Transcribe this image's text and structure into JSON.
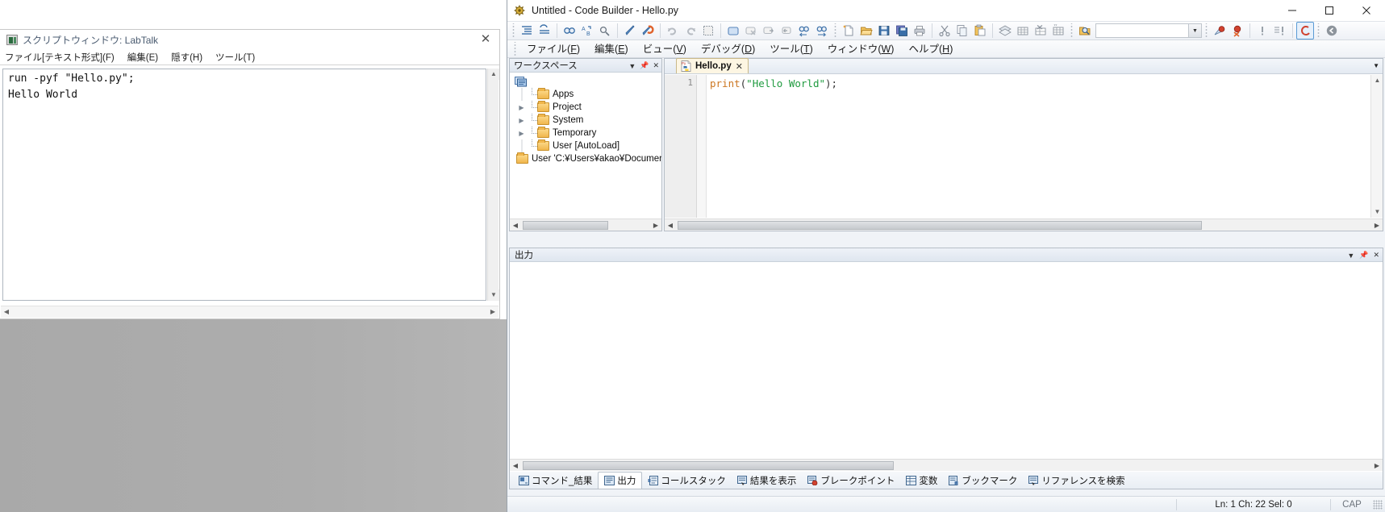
{
  "labtalk": {
    "title": "スクリプトウィンドウ: LabTalk",
    "icon": "script-window-icon",
    "close_label": "✕",
    "menus": [
      {
        "label": "ファイル[テキスト形式](F)"
      },
      {
        "label": "編集(E)"
      },
      {
        "label": "隠す(H)"
      },
      {
        "label": "ツール(T)"
      }
    ],
    "content_line1": "run -pyf \"Hello.py\";",
    "content_line2": "Hello World"
  },
  "codebuilder": {
    "title": "Untitled - Code Builder - Hello.py",
    "window_buttons": {
      "minimize": "minimize-button",
      "maximize": "maximize-button",
      "close": "close-button"
    },
    "toolbar_groups": [
      {
        "buttons": [
          {
            "name": "indent-lines-icon"
          },
          {
            "name": "unindent-lines-icon"
          }
        ]
      },
      {
        "buttons": [
          {
            "name": "find-icon"
          },
          {
            "name": "replace-icon"
          },
          {
            "name": "find-in-files-icon"
          }
        ]
      },
      {
        "buttons": [
          {
            "name": "build-icon"
          },
          {
            "name": "rebuild-icon"
          }
        ]
      },
      {
        "buttons": [
          {
            "name": "undo-icon"
          },
          {
            "name": "redo-icon"
          },
          {
            "name": "select-all-icon"
          }
        ]
      },
      {
        "buttons": [
          {
            "name": "run-icon"
          },
          {
            "name": "stop-icon"
          },
          {
            "name": "step-over-icon"
          },
          {
            "name": "step-out-icon"
          },
          {
            "name": "find-prev-icon"
          },
          {
            "name": "find-next-icon"
          }
        ]
      },
      {
        "buttons": [
          {
            "name": "new-file-icon"
          },
          {
            "name": "open-file-icon"
          },
          {
            "name": "save-icon"
          },
          {
            "name": "save-all-icon"
          },
          {
            "name": "print-icon"
          }
        ]
      },
      {
        "buttons": [
          {
            "name": "cut-icon"
          },
          {
            "name": "copy-icon"
          },
          {
            "name": "paste-icon"
          }
        ]
      },
      {
        "buttons": [
          {
            "name": "layers-icon"
          },
          {
            "name": "add-watch-icon"
          },
          {
            "name": "remove-watch-icon"
          },
          {
            "name": "new-watch-icon"
          }
        ]
      },
      {
        "buttons": [
          {
            "name": "search-folder-icon"
          }
        ],
        "combo": {
          "name": "search-combo",
          "value": "",
          "placeholder": ""
        }
      },
      {
        "buttons": [
          {
            "name": "breakpoint-icon"
          },
          {
            "name": "remove-breakpoint-icon"
          }
        ]
      },
      {
        "buttons": [
          {
            "name": "break-icon"
          },
          {
            "name": "break-all-icon"
          }
        ]
      },
      {
        "buttons": [
          {
            "name": "compile-icon"
          }
        ]
      },
      {
        "buttons": [
          {
            "name": "back-icon"
          }
        ]
      }
    ],
    "menus": [
      {
        "label": "ファイル",
        "accel": "F"
      },
      {
        "label": "編集",
        "accel": "E"
      },
      {
        "label": "ビュー",
        "accel": "V"
      },
      {
        "label": "デバッグ",
        "accel": "D"
      },
      {
        "label": "ツール",
        "accel": "T"
      },
      {
        "label": "ウィンドウ",
        "accel": "W"
      },
      {
        "label": "ヘルプ",
        "accel": "H"
      }
    ],
    "workspace": {
      "title": "ワークスペース",
      "root_icon": "workspace-root-icon",
      "items": [
        {
          "label": "Apps",
          "expandable": false
        },
        {
          "label": "Project",
          "expandable": true
        },
        {
          "label": "System",
          "expandable": true
        },
        {
          "label": "Temporary",
          "expandable": true
        },
        {
          "label": "User [AutoLoad]",
          "expandable": false
        },
        {
          "label": "User 'C:¥Users¥akao¥Document",
          "expandable": false
        }
      ]
    },
    "editor": {
      "tab": {
        "label": "Hello.py",
        "icon": "python-file-icon",
        "close": "✕"
      },
      "line_number": "1",
      "code": {
        "keyword": "print",
        "paren_open": "(",
        "string": "\"Hello World\"",
        "paren_close": ");"
      }
    },
    "output": {
      "title": "出力",
      "content": "",
      "tabs": [
        {
          "label": "コマンド_結果",
          "icon": "command-results-icon",
          "selected": false
        },
        {
          "label": "出力",
          "icon": "output-icon",
          "selected": true
        },
        {
          "label": "コールスタック",
          "icon": "call-stack-icon",
          "selected": false
        },
        {
          "label": "結果を表示",
          "icon": "show-results-icon",
          "selected": false
        },
        {
          "label": "ブレークポイント",
          "icon": "breakpoints-icon",
          "selected": false
        },
        {
          "label": "変数",
          "icon": "variables-icon",
          "selected": false
        },
        {
          "label": "ブックマーク",
          "icon": "bookmarks-icon",
          "selected": false
        },
        {
          "label": "リファレンスを検索",
          "icon": "find-references-icon",
          "selected": false
        }
      ]
    },
    "statusbar": {
      "position": "Ln: 1 Ch: 22 Sel: 0",
      "caps": "CAP"
    }
  },
  "colors": {
    "keyword": "#cc7722",
    "string": "#1f9b3f",
    "tab_active": "#fdf6e3",
    "accent": "#5a9bd5"
  }
}
